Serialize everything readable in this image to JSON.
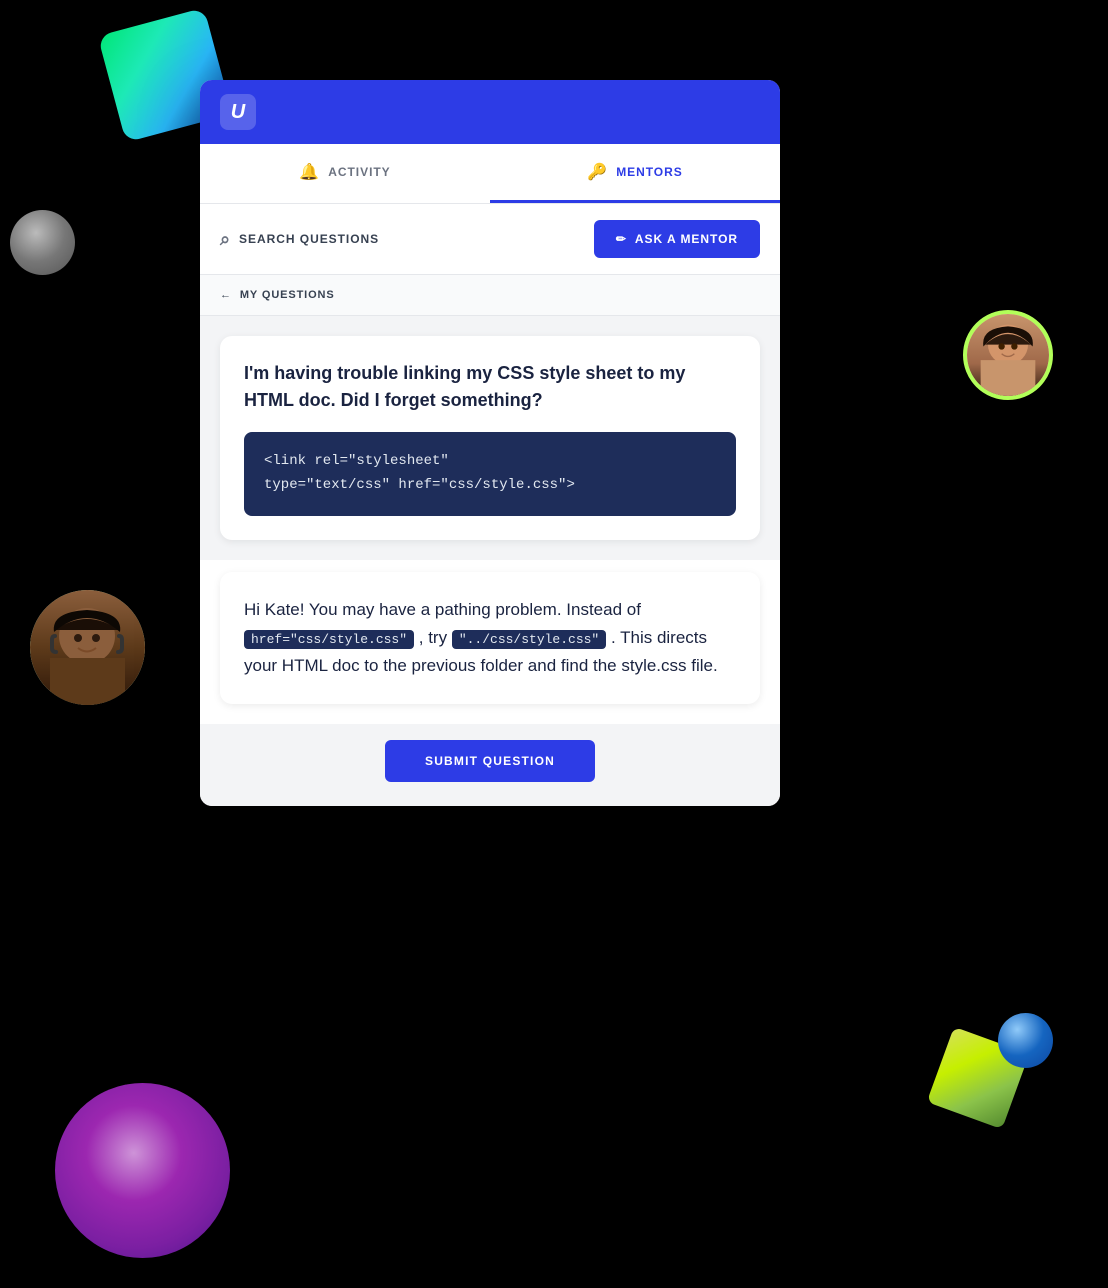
{
  "app": {
    "logo": "U",
    "header_bg": "#2d3ce6"
  },
  "tabs": [
    {
      "id": "activity",
      "label": "ACTIVITY",
      "icon": "bell",
      "active": false
    },
    {
      "id": "mentors",
      "label": "MENTORS",
      "icon": "key",
      "active": true
    }
  ],
  "toolbar": {
    "search_label": "SEARCH QUESTIONS",
    "ask_label": "ASK A MENTOR"
  },
  "back_nav": {
    "label": "MY QUESTIONS"
  },
  "question": {
    "text": "I'm having trouble linking my CSS style sheet to my HTML doc. Did I forget something?",
    "code_line1": "<link rel=\"stylesheet\"",
    "code_line2": "type=\"text/css\" href=\"css/style.css\">"
  },
  "answer": {
    "intro": "Hi Kate! You may have a pathing problem. Instead of ",
    "code1": "href=\"css/style.css\"",
    "middle": " , try ",
    "code2": "\"../css/style.css\"",
    "outro": " . This directs your HTML doc to the previous folder and find the style.css file."
  },
  "submit_button": "SUBMIT QUESTION"
}
